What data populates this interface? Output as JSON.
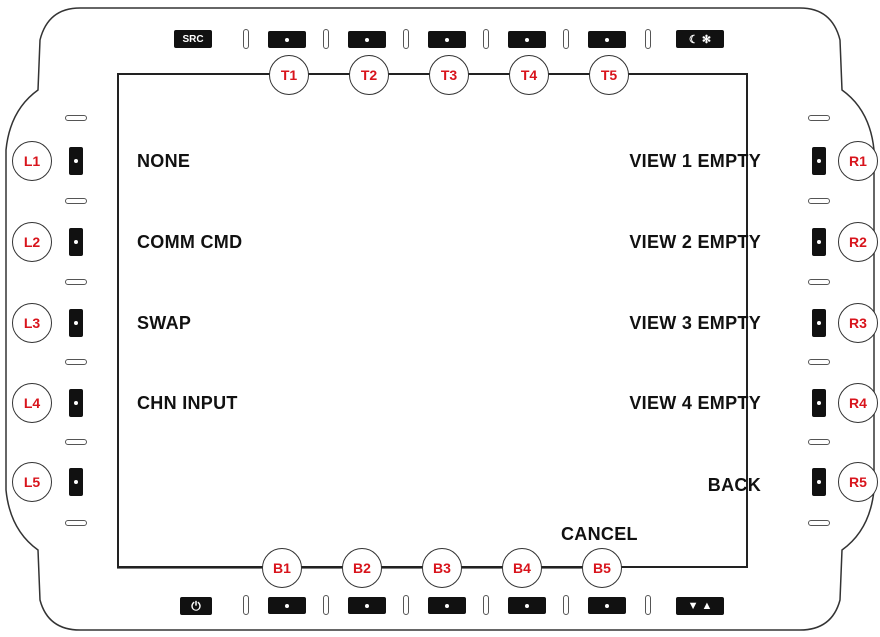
{
  "top_controls": {
    "src_label": "SRC",
    "brightness_icons": "☾ ✻",
    "arrows_label": "▼ ▲",
    "power_icon": "⏻"
  },
  "softkeys": {
    "top": [
      "T1",
      "T2",
      "T3",
      "T4",
      "T5"
    ],
    "bottom": [
      "B1",
      "B2",
      "B3",
      "B4",
      "B5"
    ],
    "left": [
      "L1",
      "L2",
      "L3",
      "L4",
      "L5"
    ],
    "right": [
      "R1",
      "R2",
      "R3",
      "R4",
      "R5"
    ]
  },
  "menu": {
    "left": [
      "NONE",
      "COMM CMD",
      "SWAP",
      "CHN INPUT"
    ],
    "right": [
      "VIEW 1 EMPTY",
      "VIEW 2 EMPTY",
      "VIEW 3 EMPTY",
      "VIEW 4 EMPTY",
      "BACK"
    ],
    "bottom_b5": "CANCEL"
  },
  "colors": {
    "key_label": "#d8141c",
    "button": "#111111"
  }
}
